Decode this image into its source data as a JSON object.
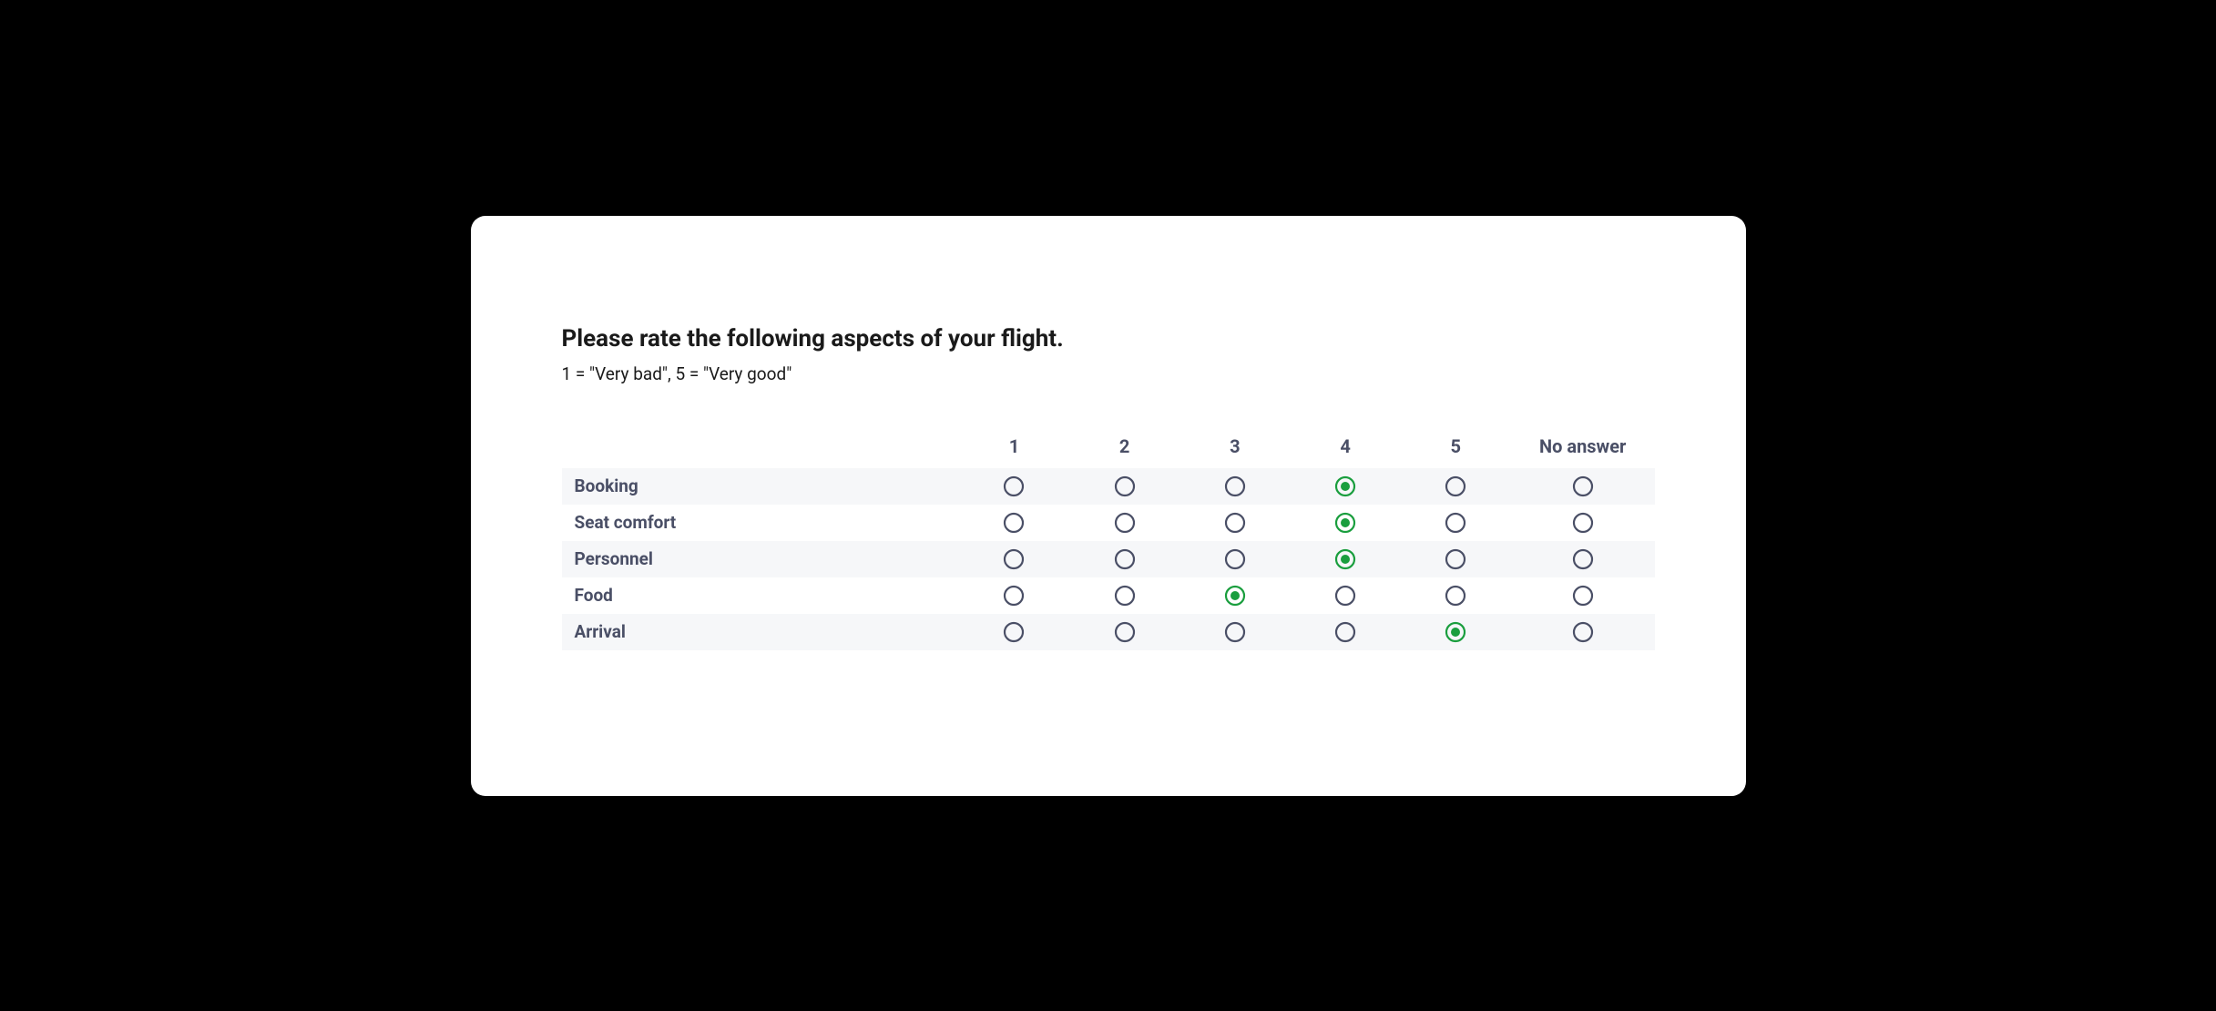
{
  "question": {
    "title": "Please rate the following aspects of your flight.",
    "subtitle": "1 = \"Very bad\", 5 = \"Very good\""
  },
  "columns": [
    "1",
    "2",
    "3",
    "4",
    "5",
    "No answer"
  ],
  "rows": [
    {
      "label": "Booking",
      "selected_index": 3
    },
    {
      "label": "Seat comfort",
      "selected_index": 3
    },
    {
      "label": "Personnel",
      "selected_index": 3
    },
    {
      "label": "Food",
      "selected_index": 2
    },
    {
      "label": "Arrival",
      "selected_index": 4
    }
  ]
}
